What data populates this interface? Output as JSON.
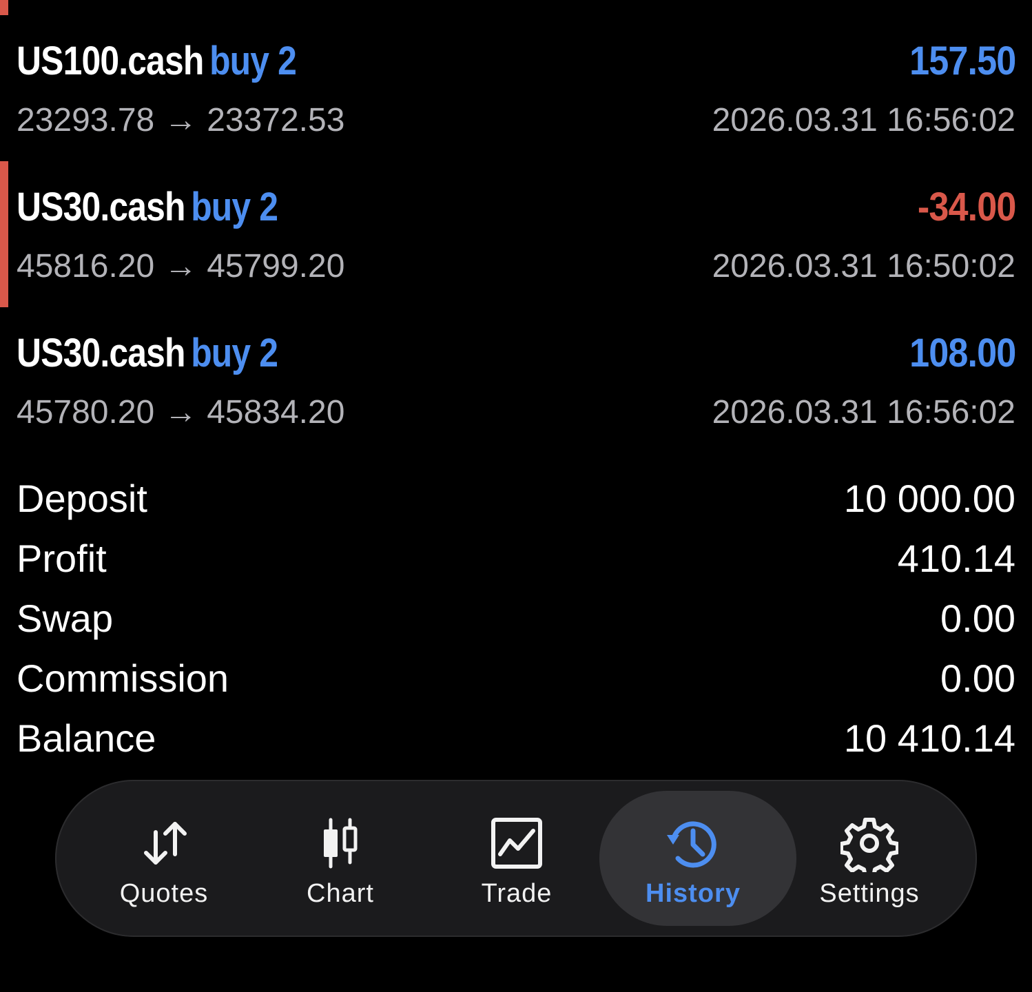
{
  "trades": [
    {
      "symbol": "US100.cash",
      "type": "buy 2",
      "profit": "157.50",
      "open_price": "23293.78",
      "arrow": "→",
      "close_price": "23372.53",
      "time": "2026.03.31 16:56:02",
      "profit_color": "#4d8ef0"
    },
    {
      "symbol": "US30.cash",
      "type": "buy 2",
      "profit": "-34.00",
      "open_price": "45816.20",
      "arrow": "→",
      "close_price": "45799.20",
      "time": "2026.03.31 16:50:02",
      "profit_color": "#d9584a"
    },
    {
      "symbol": "US30.cash",
      "type": "buy 2",
      "profit": "108.00",
      "open_price": "45780.20",
      "arrow": "→",
      "close_price": "45834.20",
      "time": "2026.03.31 16:56:02",
      "profit_color": "#4d8ef0"
    }
  ],
  "summary": {
    "deposit_label": "Deposit",
    "deposit_value": "10 000.00",
    "profit_label": "Profit",
    "profit_value": "410.14",
    "swap_label": "Swap",
    "swap_value": "0.00",
    "commission_label": "Commission",
    "commission_value": "0.00",
    "balance_label": "Balance",
    "balance_value": "10 410.14"
  },
  "tabbar": {
    "tabs": [
      {
        "label": "Quotes",
        "icon": "quotes-arrows-icon"
      },
      {
        "label": "Chart",
        "icon": "candlestick-chart-icon"
      },
      {
        "label": "Trade",
        "icon": "trade-chart-icon"
      },
      {
        "label": "History",
        "icon": "history-clock-icon",
        "active": true
      },
      {
        "label": "Settings",
        "icon": "gear-icon"
      }
    ],
    "active_color": "#4d8ef0"
  },
  "colors": {
    "background": "#000000",
    "accent_blue": "#4d8ef0",
    "loss_red": "#d9584a",
    "secondary_text": "#b3b3b8"
  }
}
